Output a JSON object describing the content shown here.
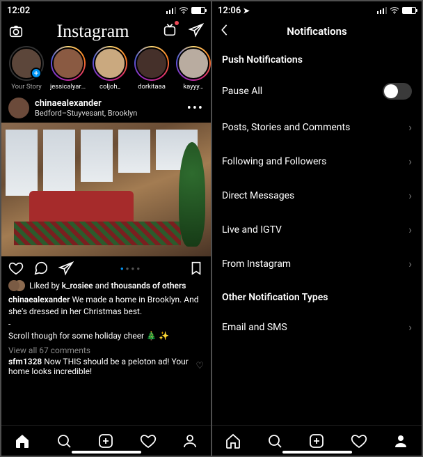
{
  "left": {
    "status_time": "12:02",
    "brand": "Instagram",
    "stories": [
      {
        "label": "Your Story",
        "own": true
      },
      {
        "label": "jessicalyarb…"
      },
      {
        "label": "coljoh_"
      },
      {
        "label": "dorkitaaa"
      },
      {
        "label": "kayyy…"
      }
    ],
    "post": {
      "user": "chinaealexander",
      "location": "Bedford–Stuyvesant, Brooklyn",
      "likes_lead": "Liked by",
      "likes_bold": "k_rosiee",
      "likes_mid": "and",
      "likes_tail": "thousands of others",
      "caption_user": "chinaealexander",
      "caption_text": "We made a home in Brooklyn. And she's dressed in her Christmas best.",
      "caption_line2": "-",
      "caption_line3": "Scroll though for some holiday cheer 🎄 ✨",
      "view_comments": "View all 67 comments",
      "comment_user": "sfm1328",
      "comment_text": "Now THIS should be a peloton ad!  Your home looks incredible!"
    }
  },
  "right": {
    "status_time": "12:06",
    "title": "Notifications",
    "section1": "Push Notifications",
    "pause": "Pause All",
    "rows": [
      "Posts, Stories and Comments",
      "Following and Followers",
      "Direct Messages",
      "Live and IGTV",
      "From Instagram"
    ],
    "section2": "Other Notification Types",
    "rows2": [
      "Email and SMS"
    ]
  }
}
